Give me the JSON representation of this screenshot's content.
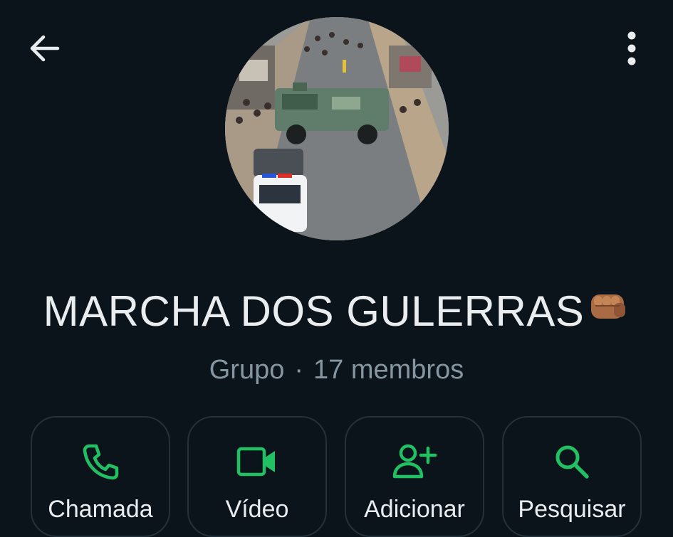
{
  "header": {
    "back_icon": "arrow-left-icon",
    "menu_icon": "more-vertical-icon"
  },
  "group": {
    "name": "MARCHA DOS GULERRAS",
    "name_emoji_icon": "oncoming-fist-emoji",
    "type": "Grupo",
    "separator": "·",
    "members": "17 membros",
    "avatar_description_icon": "group-photo"
  },
  "actions": [
    {
      "label": "Chamada",
      "icon": "phone-icon"
    },
    {
      "label": "Vídeo",
      "icon": "video-icon"
    },
    {
      "label": "Adicionar",
      "icon": "add-person-icon"
    },
    {
      "label": "Pesquisar",
      "icon": "search-icon"
    }
  ],
  "colors": {
    "background": "#0b141b",
    "accent": "#21c063",
    "text_primary": "#e9edef",
    "text_secondary": "#8696a0",
    "card_border": "#24313a"
  }
}
